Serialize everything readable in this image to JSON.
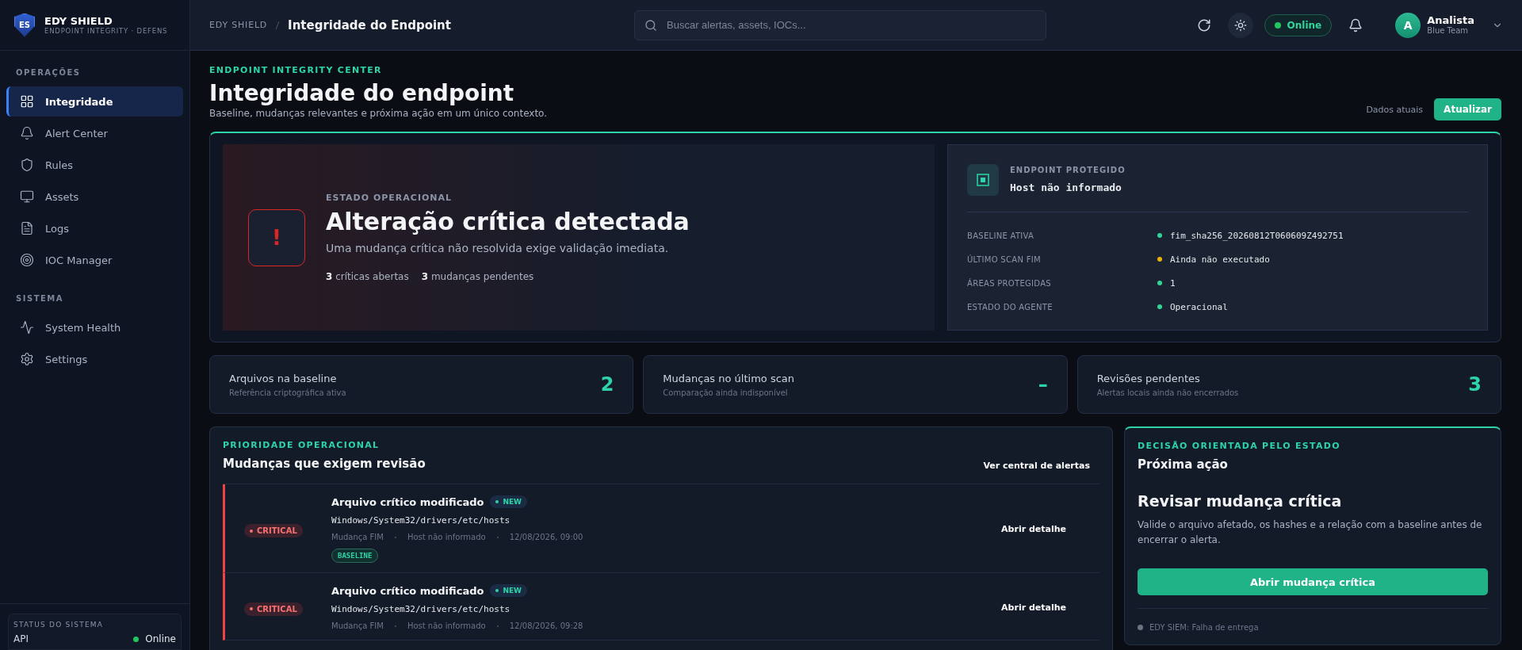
{
  "sidebar": {
    "brand": {
      "logo": "ES",
      "name": "EDY SHIELD",
      "tagline": "ENDPOINT INTEGRITY · DEFENS"
    },
    "sections": [
      {
        "title": "OPERAÇÕES",
        "items": [
          {
            "label": "Integridade",
            "selected": true
          },
          {
            "label": "Alert Center",
            "selected": false
          },
          {
            "label": "Rules",
            "selected": false
          },
          {
            "label": "Assets",
            "selected": false
          },
          {
            "label": "Logs",
            "selected": false
          },
          {
            "label": "IOC Manager",
            "selected": false
          }
        ]
      },
      {
        "title": "SISTEMA",
        "items": [
          {
            "label": "System Health",
            "selected": false
          },
          {
            "label": "Settings",
            "selected": false
          }
        ]
      }
    ],
    "status": {
      "title": "STATUS DO SISTEMA",
      "label": "API",
      "value": "Online",
      "color": "#22c55e"
    }
  },
  "topbar": {
    "breadcrumb": [
      "EDY SHIELD",
      "Integridade do Endpoint"
    ],
    "search": {
      "placeholder": "Buscar alertas, assets, IOCs..."
    },
    "connection": "Online",
    "user": {
      "initial": "A",
      "name": "Analista",
      "team": "Blue Team"
    }
  },
  "header": {
    "eyebrow": "ENDPOINT INTEGRITY CENTER",
    "title": "Integridade do endpoint",
    "subtitle": "Baseline, mudanças relevantes e próxima ação em um único contexto.",
    "freshness": "Dados atuais",
    "refresh": "Atualizar"
  },
  "hero": {
    "kind": "critical",
    "icon": "!",
    "eyebrow": "ESTADO OPERACIONAL",
    "title": "Alteração crítica detectada",
    "description": "Uma mudança crítica não resolvida exige validação imediata.",
    "counts": [
      "**3** críticas abertas",
      "**3** mudanças pendentes"
    ],
    "endpoint": {
      "eyebrow": "ENDPOINT PROTEGIDO",
      "host": "Host não informado",
      "facts": [
        {
          "label": "BASELINE ATIVA",
          "value": "fim_sha256_20260812T060609Z492751",
          "color": "#34d399"
        },
        {
          "label": "ÚLTIMO SCAN FIM",
          "value": "Ainda não executado",
          "color": "#eab308"
        },
        {
          "label": "ÁREAS PROTEGIDAS",
          "value": "1",
          "color": "#34d399"
        },
        {
          "label": "ESTADO DO AGENTE",
          "value": "Operacional",
          "color": "#34d399"
        }
      ]
    }
  },
  "stats": [
    {
      "title": "Arquivos na baseline",
      "subtitle": "Referência criptográfica ativa",
      "value": "2"
    },
    {
      "title": "Mudanças no último scan",
      "subtitle": "Comparação ainda indisponível",
      "value": "–"
    },
    {
      "title": "Revisões pendentes",
      "subtitle": "Alertas locais ainda não encerrados",
      "value": "3"
    }
  ],
  "changes": {
    "eyebrow": "PRIORIDADE OPERACIONAL",
    "title": "Mudanças que exigem revisão",
    "link": "Ver central de alertas",
    "rows": [
      {
        "kind": "critical",
        "severity_label": "CRITICAL",
        "title": "Arquivo crítico modificado",
        "badge": "NEW",
        "path": "Windows/System32/drivers/etc/hosts",
        "meta": [
          "Mudança FIM",
          "Host não informado",
          "12/08/2026, 09:00"
        ],
        "tags": [
          "BASELINE"
        ],
        "action": "Abrir detalhe"
      },
      {
        "kind": "critical",
        "severity_label": "CRITICAL",
        "title": "Arquivo crítico modificado",
        "badge": "NEW",
        "path": "Windows/System32/drivers/etc/hosts",
        "meta": [
          "Mudança FIM",
          "Host não informado",
          "12/08/2026, 09:28"
        ],
        "action": "Abrir detalhe"
      }
    ]
  },
  "next_action": {
    "eyebrow": "DECISÃO ORIENTADA PELO ESTADO",
    "title": "Próxima ação",
    "heading": "Revisar mudança crítica",
    "description": "Valide o arquivo afetado, os hashes e a relação com a baseline antes de encerrar o alerta.",
    "button": "Abrir mudança crítica",
    "footer": {
      "text": "EDY SIEM: Falha de entrega",
      "color": "#6b7280"
    }
  }
}
